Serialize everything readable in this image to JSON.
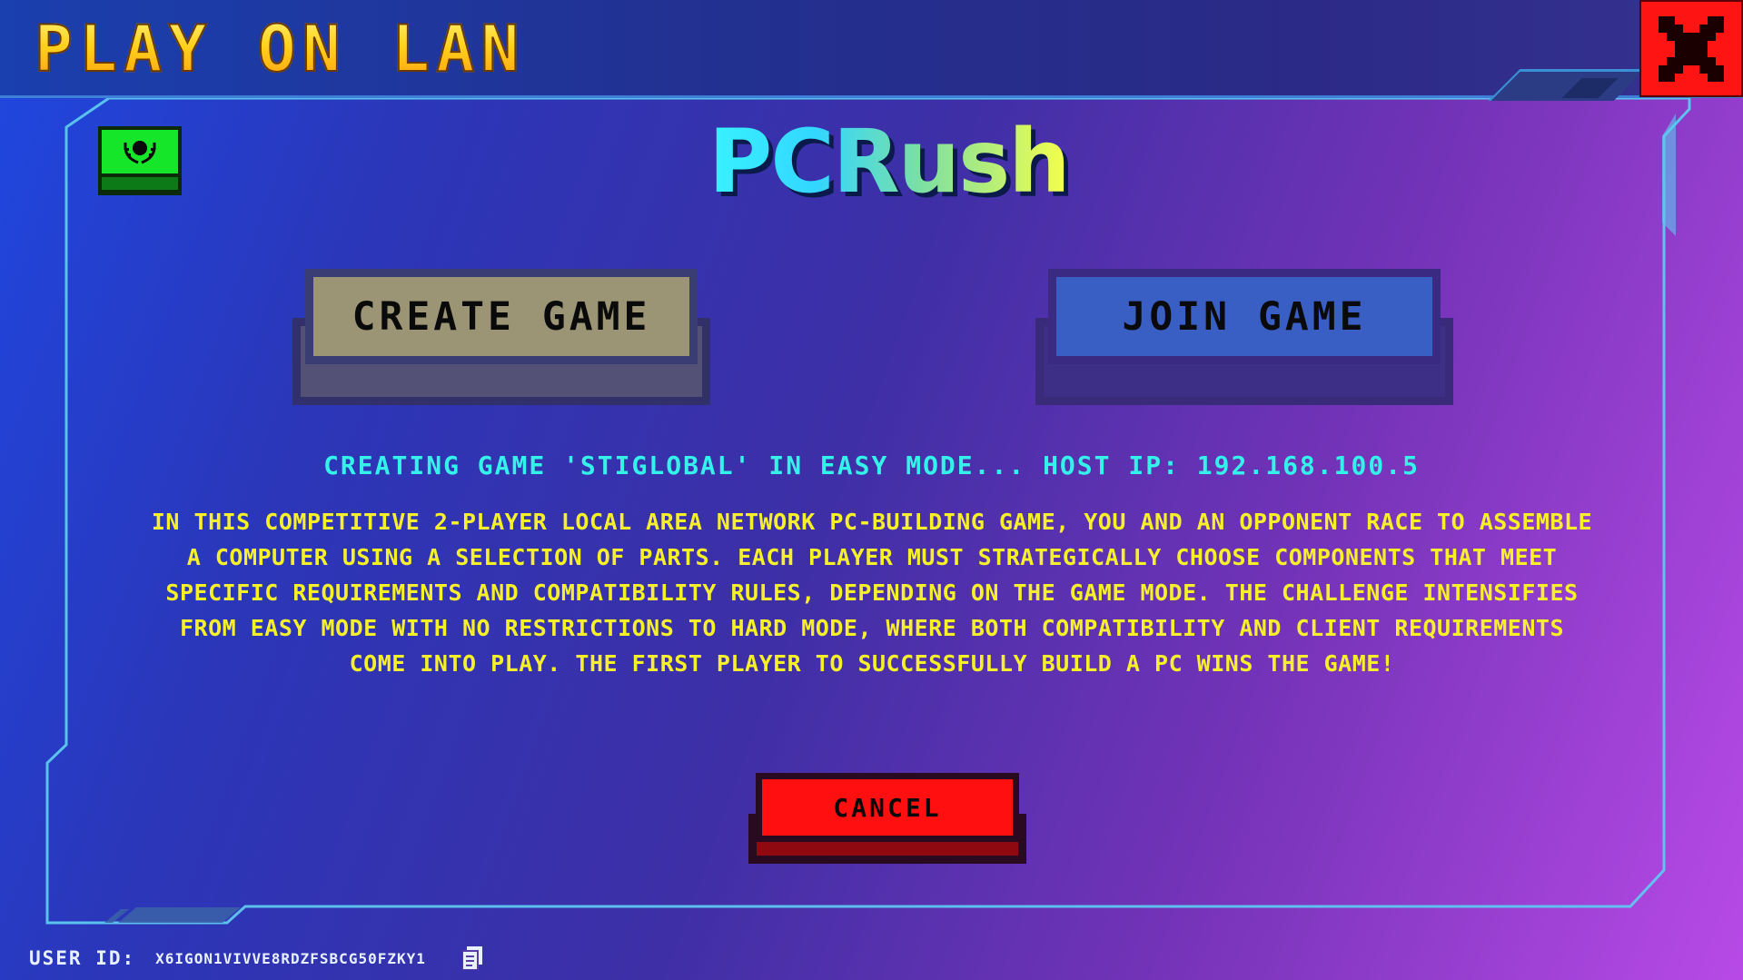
{
  "window": {
    "title": "Play on LAN",
    "close_icon": "close-x-icon"
  },
  "header": {
    "logo": "PCRush",
    "server_icon": "server-laurel-icon"
  },
  "buttons": {
    "create": "Create Game",
    "join": "Join Game",
    "cancel": "Cancel"
  },
  "status": {
    "text": "Creating game 'STIGLOBAL' in Easy mode... Host IP: 192.168.100.5"
  },
  "description": {
    "text": "In this competitive 2-player Local Area Network PC-building game, you and an opponent race to assemble a computer using a selection of parts. Each player must strategically choose components that meet specific requirements and compatibility rules, depending on the game mode. The challenge intensifies from Easy mode with no restrictions to Hard mode, where both compatibility and client requirements come into play. The first player to successfully build a PC wins the game!"
  },
  "footer": {
    "user_id_label": "User ID:",
    "user_id_value": "X6IGoN1VIVVE8RDZFSBCG50FZKY1",
    "copy_icon": "copy-clipboard-icon"
  },
  "colors": {
    "title_gradient": "#ffd21c",
    "close_button": "#ff1414",
    "status_text": "#34f2ea",
    "description_text": "#f5f02a",
    "create_button": "#9b9576",
    "join_button": "#3a5fc4",
    "cancel_button": "#ff0f0f",
    "frame_border": "#5fc6f0"
  }
}
